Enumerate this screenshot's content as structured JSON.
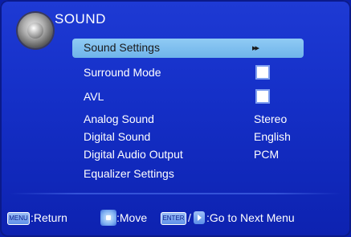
{
  "header": {
    "title": "SOUND",
    "icon": "speaker-icon"
  },
  "menu": {
    "items": [
      {
        "label": "Sound Settings",
        "control": "arrows",
        "value": "▸▸",
        "selected": true
      },
      {
        "label": "Surround Mode",
        "control": "checkbox"
      },
      {
        "label": "AVL",
        "control": "checkbox"
      },
      {
        "label": "Analog Sound",
        "control": "value",
        "value": "Stereo"
      },
      {
        "label": "Digital Sound",
        "control": "value",
        "value": "English"
      },
      {
        "label": "Digital Audio Output",
        "control": "value",
        "value": "PCM"
      },
      {
        "label": "Equalizer Settings",
        "control": "none"
      }
    ]
  },
  "footer": {
    "menu_key": "MENU",
    "return_text": ":Return",
    "move_text": ":Move",
    "enter_key": "ENTER",
    "slash": "/",
    "next_text": ":Go to Next Menu"
  },
  "colors": {
    "background": "#1530c8",
    "highlight": "#7cbeee",
    "text": "#ffffff"
  }
}
